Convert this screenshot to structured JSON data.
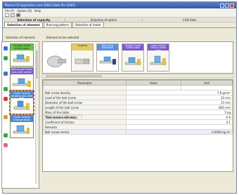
{
  "window": {
    "title": "Mecha-CD  Application size (2002)    Data file (2002)"
  },
  "menu": [
    "File (F)",
    "Option (O)",
    "Help"
  ],
  "capacity_bar": {
    "title": "Selection of capacity",
    "option": "Selection of option",
    "cad": "CAD data"
  },
  "tabs": {
    "selection": "Selection of element",
    "running": "Running pattern",
    "motor": "Selection of motor"
  },
  "left_panel": {
    "header": "Selection of element",
    "elements": [
      {
        "label": "Straight linear sliding table"
      },
      {
        "label": "Belt-driven linear axis with carrier"
      },
      {
        "label": "Linear motion rotating axis with belt"
      },
      {
        "label": "Linear motion through table"
      }
    ]
  },
  "right_panel": {
    "header": "Element to be selected",
    "cards": [
      {
        "label": "Coupling"
      },
      {
        "label": "Ball screw horizontal"
      },
      {
        "label": "Straight linear sliding table"
      },
      {
        "label": "Linear motion vertical linear body"
      }
    ]
  },
  "table": {
    "headers": [
      "Parameter",
      "Value",
      "Unit"
    ],
    "subtitle": "Ball screw horizontal",
    "rows": [
      {
        "name": "Ball screw density",
        "value": "7.8 g/cm³"
      },
      {
        "name": "Lead of the ball screw",
        "value": "10 mm"
      },
      {
        "name": "Diameter of the ball screw",
        "value": "15 mm"
      },
      {
        "name": "Length of the ball screw",
        "value": "800 mm"
      },
      {
        "name": "Mass of the table",
        "value": "5 kg"
      },
      {
        "name": "Transmission efficiency",
        "value": "0.9"
      },
      {
        "name": "Coefficient of friction",
        "value": "0.1"
      },
      {
        "name": "Remarks",
        "value": ""
      },
      {
        "name": "Ball screw inertia",
        "value": "0.0000 kg·m²"
      }
    ]
  },
  "colors": {
    "accent": "#5a8fe0",
    "element_green": "#6bbf4f",
    "element_purple": "#7a5cc9",
    "card_gold": "#e0b83a"
  }
}
